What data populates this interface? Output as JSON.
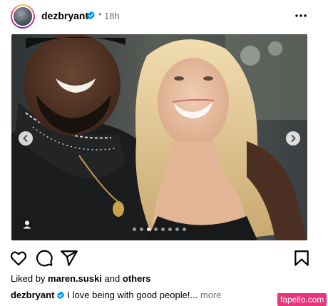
{
  "header": {
    "username": "dezbryant",
    "separator": "•",
    "time": "18h"
  },
  "photo": {
    "carousel_slides": 8,
    "active_slide": 3
  },
  "likes": {
    "prefix": "Liked by",
    "user": "maren.suski",
    "conjunction": "and",
    "others": "others"
  },
  "caption": {
    "username": "dezbryant",
    "text": "I love being with good people!...",
    "more": "more"
  },
  "watermark": "fapello.com",
  "colors": {
    "verified": "#0095f6",
    "secondary_text": "#737373",
    "watermark_bg": "#e8347a"
  },
  "icons": [
    "verified-badge-icon",
    "more-options-icon",
    "chevron-left-icon",
    "chevron-right-icon",
    "person-tag-icon",
    "heart-icon",
    "comment-icon",
    "share-icon",
    "bookmark-icon"
  ]
}
